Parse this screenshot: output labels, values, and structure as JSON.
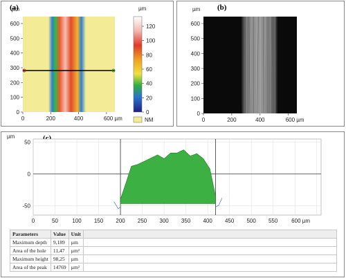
{
  "panel_a": {
    "label": "(a)",
    "unit_top": "µm",
    "y_ticks": [
      "600",
      "500",
      "400",
      "300",
      "200",
      "100",
      "0"
    ],
    "x_ticks": [
      "0",
      "200",
      "400",
      "600 µm"
    ],
    "colorbar_unit": "µm",
    "colorbar_ticks": [
      "120",
      "100",
      "80",
      "60",
      "40",
      "20",
      "0"
    ],
    "nm_label": "NM",
    "colors": {
      "background": "#f3eb95",
      "nm_box": "#f3eb95"
    }
  },
  "panel_b": {
    "label": "(b)",
    "unit_top": "µm",
    "y_ticks": [
      "600",
      "500",
      "400",
      "300",
      "200",
      "100",
      "0"
    ],
    "x_ticks": [
      "0",
      "200",
      "400",
      "600 µm"
    ]
  },
  "panel_c": {
    "label": "(c)",
    "unit_top": "µm",
    "y_ticks": [
      "50",
      "0",
      "-50"
    ],
    "x_ticks": [
      "0",
      "50",
      "100",
      "150",
      "200",
      "250",
      "300",
      "350",
      "400",
      "450",
      "500",
      "550",
      "600 µm"
    ],
    "fill_color": "#3cb043"
  },
  "chart_data": {
    "type": "area",
    "x_unit": "µm",
    "y_unit": "µm",
    "xlim": [
      0,
      660
    ],
    "ylim": [
      -65,
      55
    ],
    "x": [
      200,
      210,
      225,
      240,
      255,
      270,
      285,
      300,
      315,
      330,
      345,
      360,
      375,
      390,
      405,
      418
    ],
    "y": [
      -40,
      -20,
      12,
      15,
      20,
      25,
      30,
      24,
      33,
      33,
      38,
      28,
      32,
      24,
      8,
      -35
    ]
  },
  "parameters": {
    "headers": [
      "Parameters",
      "Value",
      "Unit"
    ],
    "rows": [
      {
        "name": "Maximum depth",
        "value": "9,189",
        "unit": "µm"
      },
      {
        "name": "Area of the hole",
        "value": "11,47",
        "unit": "µm²"
      },
      {
        "name": "Maximum height",
        "value": "98,25",
        "unit": "µm"
      },
      {
        "name": "Area of the peak",
        "value": "14769",
        "unit": "µm²"
      }
    ]
  }
}
